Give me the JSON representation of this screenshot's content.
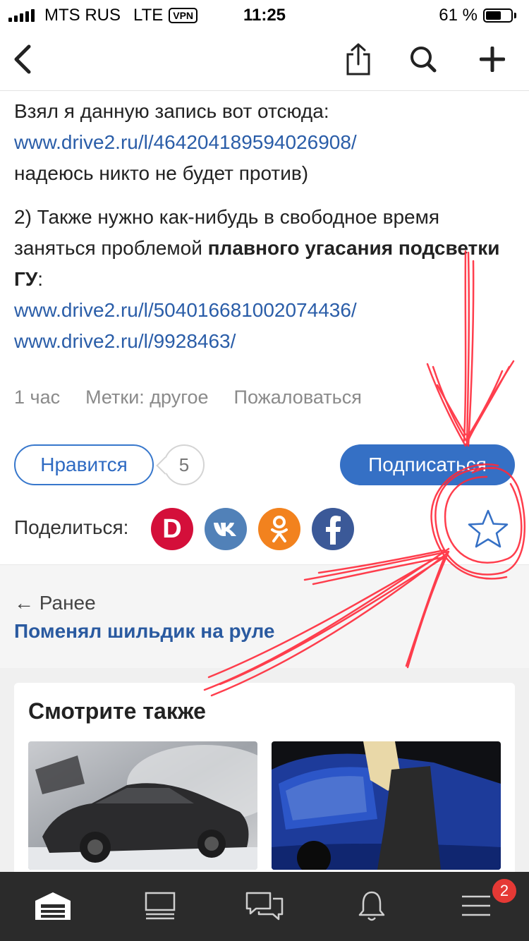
{
  "status_bar": {
    "carrier": "MTS RUS",
    "network": "LTE",
    "vpn": "VPN",
    "time": "11:25",
    "battery_text": "61 %",
    "battery_level": 0.61
  },
  "nav": {
    "back_icon": "chevron-left-icon",
    "share_icon": "share-icon",
    "search_icon": "search-icon",
    "add_icon": "plus-icon"
  },
  "article": {
    "line1": "Взял я данную запись вот отсюда:",
    "link1": "www.drive2.ru/l/464204189594026908/",
    "line2": "надеюсь никто не будет против)",
    "para2_start": "2) Также нужно как-нибудь в свободное время заняться проблемой ",
    "para2_bold": "плавного угасания подсветки ГУ",
    "para2_end": ":",
    "link2": "www.drive2.ru/l/504016681002074436/",
    "link3": "www.drive2.ru/l/9928463/"
  },
  "meta": {
    "time_ago": "1 час",
    "tags": "Метки: другое",
    "report": "Пожаловаться"
  },
  "actions": {
    "like_label": "Нравится",
    "like_count": "5",
    "subscribe_label": "Подписаться"
  },
  "share": {
    "label": "Поделиться:",
    "drive2_glyph": "D",
    "services": [
      {
        "name": "drive2",
        "color": "#d40f3a"
      },
      {
        "name": "vk",
        "color": "#5181b8"
      },
      {
        "name": "odnoklassniki",
        "color": "#f2821e"
      },
      {
        "name": "facebook",
        "color": "#3b5998"
      }
    ],
    "favorite_icon": "star-icon"
  },
  "prev": {
    "label": "← Ранее",
    "title": "Поменял шильдик на руле"
  },
  "see_also": {
    "title": "Смотрите также",
    "thumbnails": [
      "burned-car-photo",
      "blue-car-photo"
    ]
  },
  "tabbar": {
    "items": [
      "garage-icon",
      "feed-icon",
      "messages-icon",
      "notifications-icon",
      "menu-icon"
    ],
    "menu_badge": "2"
  },
  "colors": {
    "accent": "#3570c5",
    "link": "#2a5da8",
    "annotation": "#ff2a3a",
    "tabbar_bg": "#2b2b2b"
  }
}
